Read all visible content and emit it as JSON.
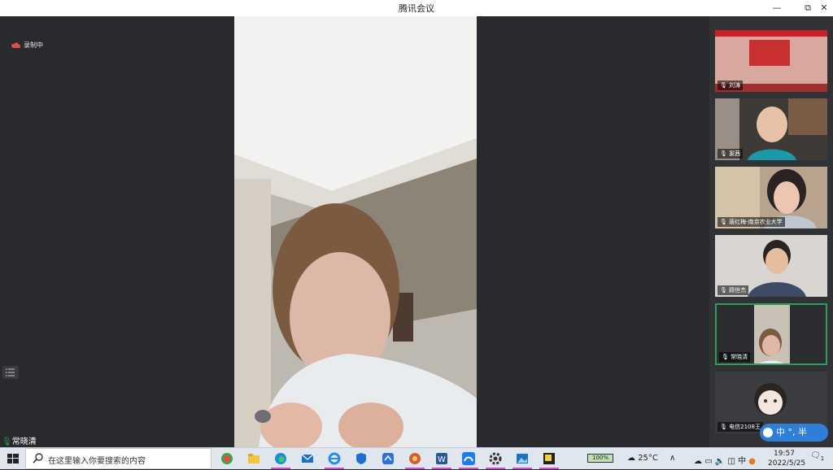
{
  "window": {
    "title": "腾讯会议",
    "minimize": "—",
    "maximize": "⧉",
    "close": "✕"
  },
  "recording": {
    "label": "录制中"
  },
  "speaker": {
    "name": "常晓清"
  },
  "participants": [
    {
      "name": "刘涛"
    },
    {
      "name": "窦茜"
    },
    {
      "name": "唐红梅-南京农业大学"
    },
    {
      "name": "顾世杰"
    },
    {
      "name": "常晓清"
    },
    {
      "name": "电信2108王"
    }
  ],
  "ime": {
    "text": "中 °, 半"
  },
  "taskbar": {
    "search_placeholder": "在这里输入你要搜索的内容",
    "battery": "100%",
    "weather": "25°C",
    "time": "19:57",
    "date": "2022/5/25",
    "notification_count": "1"
  },
  "colors": {
    "accent_green": "#2e9d57",
    "ime_blue": "#2f7fd8",
    "taskbar_marker": "#d04bd7"
  }
}
